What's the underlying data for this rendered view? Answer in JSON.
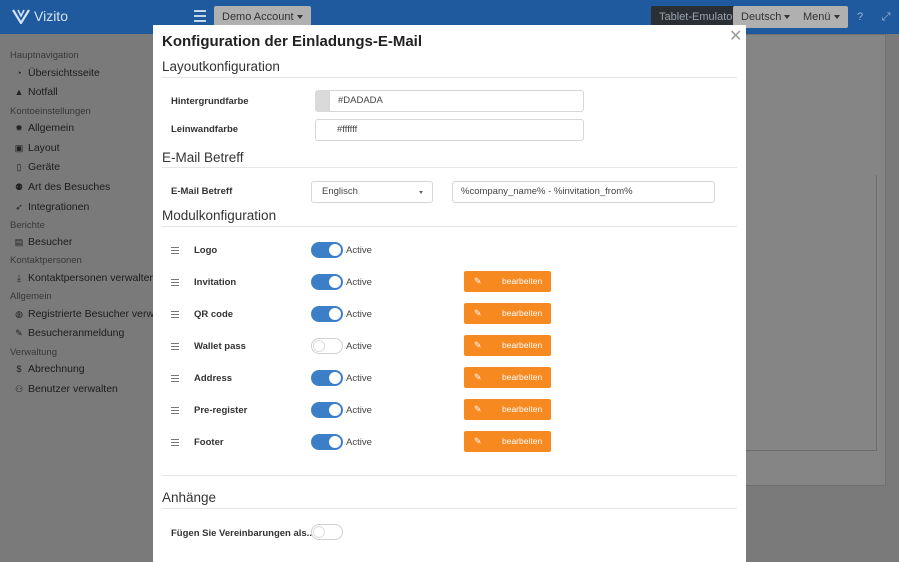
{
  "app": {
    "logo_text": "Vizito"
  },
  "topbar": {
    "account_label": "Demo Account",
    "tablet_label": "Tablet-Emulator",
    "language_label": "Deutsch",
    "menu_label": "Menü"
  },
  "sidebar": {
    "sections": [
      {
        "title": "Hauptnavigation",
        "items": [
          {
            "label": "Übersichtsseite",
            "icon": "dashboard-icon"
          },
          {
            "label": "Notfall",
            "icon": "warning-icon"
          }
        ]
      },
      {
        "title": "Kontoeinstellungen",
        "items": [
          {
            "label": "Allgemein",
            "icon": "gear-icon"
          },
          {
            "label": "Layout",
            "icon": "image-icon"
          },
          {
            "label": "Geräte",
            "icon": "tablet-icon"
          },
          {
            "label": "Art des Besuches",
            "icon": "users-icon"
          },
          {
            "label": "Integrationen",
            "icon": "rocket-icon"
          }
        ]
      },
      {
        "title": "Berichte",
        "items": [
          {
            "label": "Besucher",
            "icon": "book-icon"
          }
        ]
      },
      {
        "title": "Kontaktpersonen",
        "items": [
          {
            "label": "Kontaktpersonen verwalten",
            "icon": "download-icon"
          }
        ]
      },
      {
        "title": "Allgemein",
        "items": [
          {
            "label": "Registrierte Besucher verwalten",
            "icon": "globe-icon"
          },
          {
            "label": "Besucheranmeldung",
            "icon": "pencil-icon"
          }
        ]
      },
      {
        "title": "Verwaltung",
        "items": [
          {
            "label": "Abrechnung",
            "icon": "dollar-icon"
          },
          {
            "label": "Benutzer verwalten",
            "icon": "user-plus-icon"
          }
        ]
      }
    ]
  },
  "modal": {
    "title": "Konfiguration der Einladungs-E-Mail",
    "layout_section": {
      "heading": "Layoutkonfiguration",
      "background_label": "Hintergrundfarbe",
      "background_value": "#DADADA",
      "canvas_label": "Leinwandfarbe",
      "canvas_value": "#ffffff"
    },
    "subject_section": {
      "heading": "E-Mail Betreff",
      "label": "E-Mail Betreff",
      "language": "Englisch",
      "subject_value": "%company_name% - %invitation_from%"
    },
    "modules_section": {
      "heading": "Modulkonfiguration",
      "active_label": "Active",
      "edit_label": "bearbeiten",
      "modules": [
        {
          "name": "Logo",
          "active": true,
          "editable": false
        },
        {
          "name": "Invitation",
          "active": true,
          "editable": true
        },
        {
          "name": "QR code",
          "active": true,
          "editable": true
        },
        {
          "name": "Wallet pass",
          "active": false,
          "editable": true
        },
        {
          "name": "Address",
          "active": true,
          "editable": true
        },
        {
          "name": "Pre-register",
          "active": true,
          "editable": true
        },
        {
          "name": "Footer",
          "active": true,
          "editable": true
        }
      ]
    },
    "attachments_section": {
      "heading": "Anhänge",
      "agreements_label": "Fügen Sie Vereinbarungen als...",
      "agreements_enabled": false
    }
  },
  "colors": {
    "topbar": "#1f5a9e",
    "toggle_on": "#3d7fc6",
    "edit_button": "#f6891f",
    "swatch_background": "#DADADA"
  }
}
